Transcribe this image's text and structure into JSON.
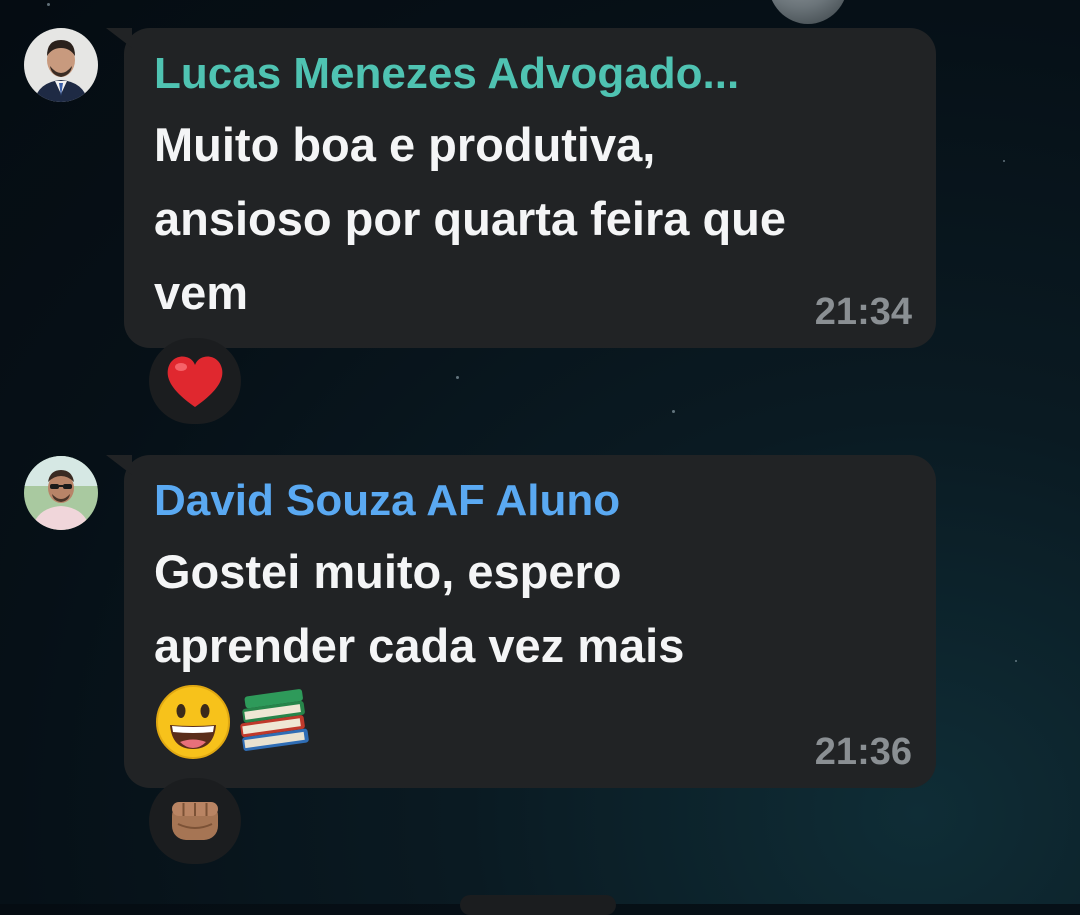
{
  "colors": {
    "bubble_bg": "#212325",
    "sender_1": "#4fc3b2",
    "sender_2": "#5aa9f2",
    "message_text": "#f4f5f6",
    "timestamp": "#8a8f93",
    "reaction_bg": "#1b1d1f"
  },
  "messages": [
    {
      "sender": "Lucas Menezes Advogado...",
      "avatar_icon": "man-in-suit-avatar",
      "text_lines": [
        "Muito boa e produtiva,",
        "ansioso por quarta feira que",
        "vem"
      ],
      "emojis": [],
      "time": "21:34",
      "reaction": "red-heart"
    },
    {
      "sender": "David Souza AF Aluno",
      "avatar_icon": "man-with-sunglasses-avatar",
      "text_lines": [
        "Gostei muito, espero",
        "aprender cada vez mais"
      ],
      "emojis": [
        "grinning-face",
        "books"
      ],
      "time": "21:36",
      "reaction": "oncoming-fist"
    }
  ]
}
